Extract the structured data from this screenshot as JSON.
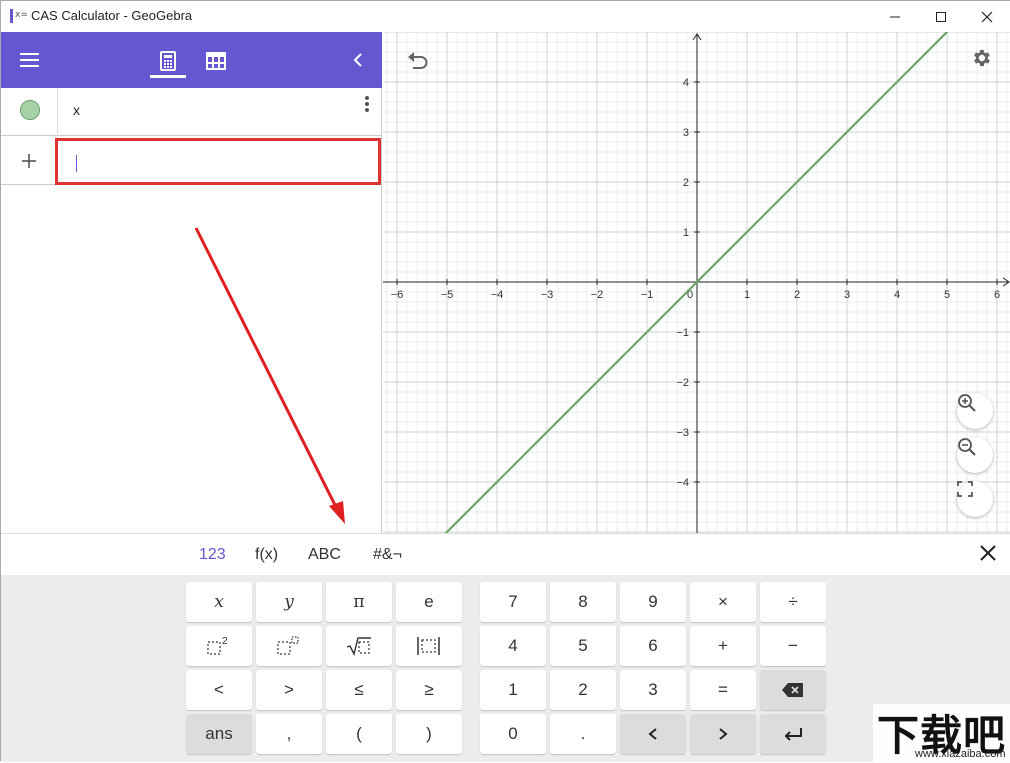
{
  "window": {
    "title": "CAS Calculator - GeoGebra",
    "app_icon_label": "x="
  },
  "toolbar": {
    "tabs": [
      {
        "name": "algebra",
        "icon": "calculator-icon",
        "active": true
      },
      {
        "name": "table",
        "icon": "table-icon",
        "active": false
      }
    ]
  },
  "algebra": {
    "rows": [
      {
        "expression": "x",
        "color": "#6a9e6a"
      }
    ],
    "input": {
      "value": ""
    }
  },
  "graph": {
    "x_ticks": [
      "−6",
      "−5",
      "−4",
      "−3",
      "−2",
      "−1",
      "0",
      "1",
      "2",
      "3",
      "4",
      "5",
      "6"
    ],
    "y_ticks": [
      "4",
      "3",
      "2",
      "1",
      "−1",
      "−2",
      "−3",
      "−4"
    ],
    "xlim": [
      -6.2,
      6.2
    ],
    "ylim": [
      -4.9,
      5.0
    ],
    "line": {
      "slope": 1,
      "intercept": 0,
      "color": "#6aa66a"
    },
    "grid": true
  },
  "keyboard": {
    "tabs": [
      "123",
      "f(x)",
      "ABC",
      "#&¬"
    ],
    "active_tab": "123",
    "left_keys": [
      [
        "x",
        "y",
        "π",
        "e"
      ],
      [
        "□²",
        "□■",
        "√□",
        "|□|"
      ],
      [
        "<",
        ">",
        "≤",
        "≥"
      ],
      [
        "ans",
        ",",
        "(",
        ")"
      ]
    ],
    "right_keys": [
      [
        "7",
        "8",
        "9",
        "×",
        "÷"
      ],
      [
        "4",
        "5",
        "6",
        "+",
        "−"
      ],
      [
        "1",
        "2",
        "3",
        "=",
        "⌫"
      ],
      [
        "0",
        ".",
        "<",
        ">",
        "↵"
      ]
    ]
  },
  "watermark": {
    "big": "下载吧",
    "small": "www.xiazaiba.com"
  }
}
